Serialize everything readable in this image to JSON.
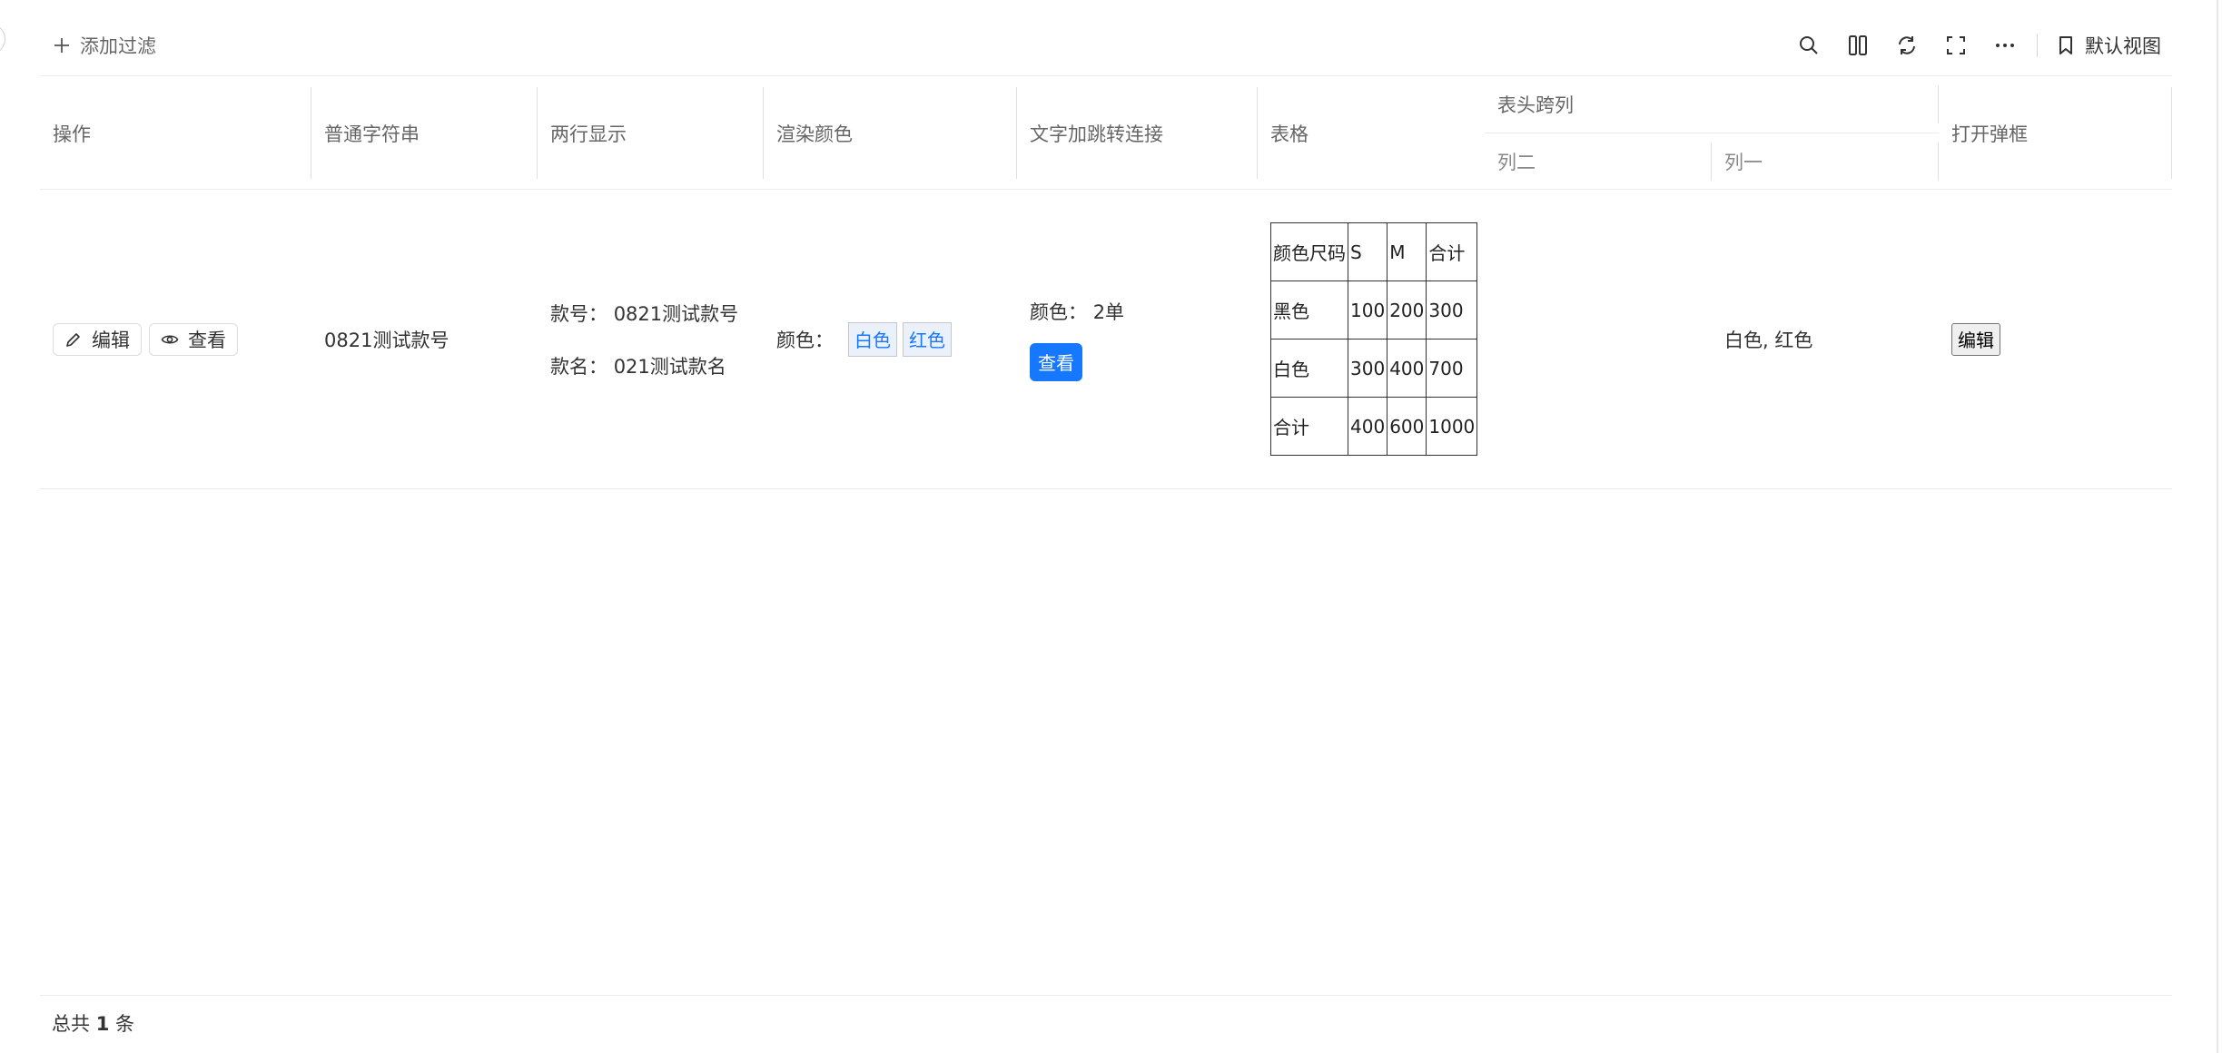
{
  "toolbar": {
    "add_filter_label": "添加过滤",
    "icons": [
      "search-icon",
      "columns-icon",
      "refresh-icon",
      "fullscreen-icon",
      "more-icon"
    ],
    "view_label": "默认视图"
  },
  "table": {
    "headers": {
      "op": "操作",
      "plain_string": "普通字符串",
      "two_lines": "两行显示",
      "render_color": "渲染颜色",
      "text_link": "文字加跳转连接",
      "table": "表格",
      "span_group": "表头跨列",
      "col_two": "列二",
      "col_one": "列一",
      "open_dialog": "打开弹框"
    },
    "row": {
      "edit_label": "编辑",
      "view_label": "查看",
      "plain_string": "0821测试款号",
      "line1_label": "款号：",
      "line1_value": "0821测试款号",
      "line2_label": "款名：",
      "line2_value": "021测试款名",
      "color_label": "颜色：",
      "tags": [
        "白色",
        "红色"
      ],
      "link_text_label": "颜色：",
      "link_text_value": "2单",
      "link_button": "查看",
      "mini_table": [
        [
          "颜色尺码",
          "S",
          "M",
          "合计"
        ],
        [
          "黑色",
          "100",
          "200",
          "300"
        ],
        [
          "白色",
          "300",
          "400",
          "700"
        ],
        [
          "合计",
          "400",
          "600",
          "1000"
        ]
      ],
      "col_two": "",
      "col_one": "白色, 红色",
      "dialog_button": "编辑"
    }
  },
  "footer": {
    "prefix": "总共",
    "count": "1",
    "suffix": "条"
  }
}
